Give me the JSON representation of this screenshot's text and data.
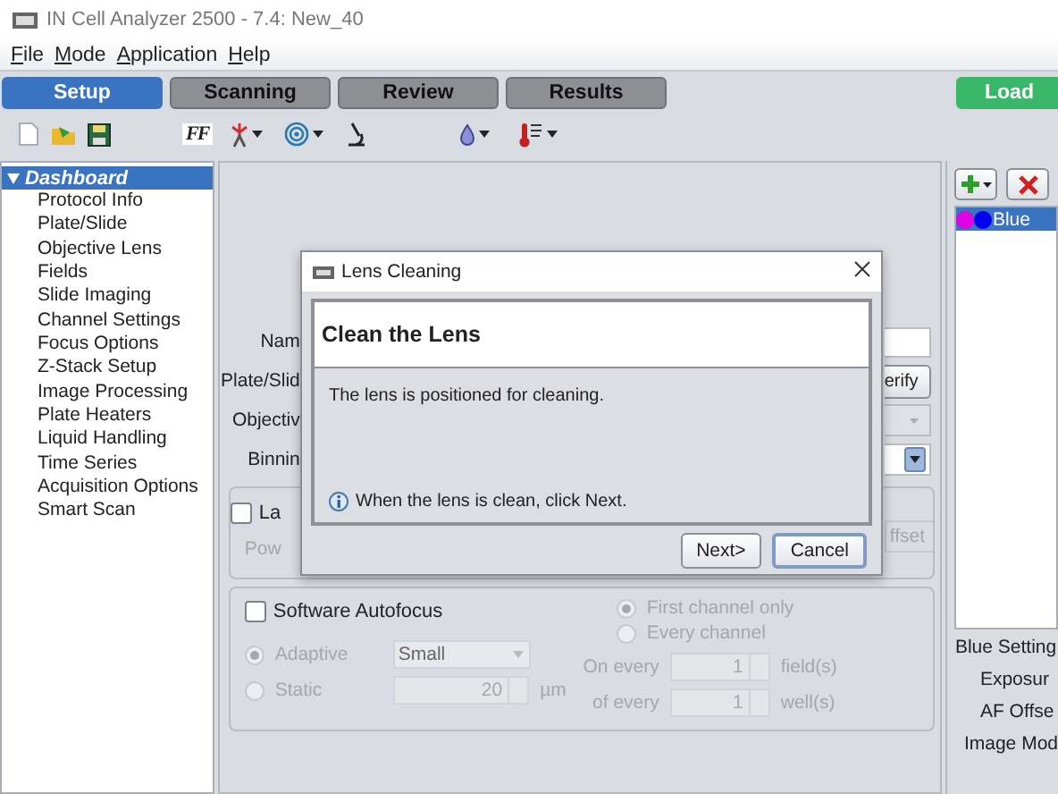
{
  "window": {
    "title": "IN Cell Analyzer 2500 - 7.4: New_40"
  },
  "menu": [
    "File",
    "Mode",
    "Application",
    "Help"
  ],
  "tabs": [
    {
      "label": "Setup",
      "selected": true
    },
    {
      "label": "Scanning",
      "selected": false
    },
    {
      "label": "Review",
      "selected": false
    },
    {
      "label": "Results",
      "selected": false
    }
  ],
  "load_button": "Load",
  "toolbar": {
    "font_button": "FF"
  },
  "sidebar": {
    "items": [
      {
        "label": "Dashboard",
        "selected": true,
        "expanded": true,
        "children": [
          {
            "label": "Protocol Info",
            "selected": false
          },
          {
            "label": "Plate/Slide",
            "selected": false
          },
          {
            "label": "Objective Lens",
            "selected": false
          },
          {
            "label": "Fields",
            "selected": false
          },
          {
            "label": "Slide Imaging",
            "selected": false
          },
          {
            "label": "Channel Settings",
            "selected": false
          },
          {
            "label": "Focus Options",
            "selected": false
          },
          {
            "label": "Z-Stack Setup",
            "selected": false
          },
          {
            "label": "Image Processing",
            "selected": false
          },
          {
            "label": "Plate Heaters",
            "selected": false
          },
          {
            "label": "Liquid Handling",
            "selected": false
          },
          {
            "label": "Time Series",
            "selected": false
          },
          {
            "label": "Acquisition Options",
            "selected": false
          },
          {
            "label": "Smart Scan",
            "selected": false
          }
        ]
      }
    ]
  },
  "form": {
    "labels": [
      "Nam",
      "Plate/Slid",
      "Objectiv",
      "Binnin"
    ],
    "verify_button": "erify",
    "laser": {
      "checkbox": "La",
      "checked": false,
      "power": "Pow",
      "offset_button": "ffset"
    }
  },
  "autofocus": {
    "label": "Software Autofocus",
    "checked": false,
    "modes": [
      {
        "label": "Adaptive",
        "selected": true
      },
      {
        "label": "Static",
        "selected": false
      }
    ],
    "size": "Small",
    "step": "20",
    "unit": "µm",
    "channels": [
      {
        "label": "First channel only",
        "selected": true
      },
      {
        "label": "Every channel",
        "selected": false
      }
    ],
    "fields_label": "On every",
    "fields_value": "1",
    "fields_unit": "field(s)",
    "wells_label": "of every",
    "wells_value": "1",
    "wells_unit": "well(s)"
  },
  "channel_panel": {
    "items": [
      {
        "label": "Blue",
        "selected": true,
        "dots": [
          {
            "color": "#e000e0"
          },
          {
            "color": "#0000f0"
          }
        ]
      }
    ],
    "labels": [
      "Blue Setting",
      "Exposur",
      "AF Offse",
      "Image Mod"
    ]
  },
  "dialog": {
    "title": "Lens Cleaning",
    "heading": "Clean the Lens",
    "message": "The lens is positioned for cleaning.",
    "hint": "When the lens is clean, click Next.",
    "buttons": [
      {
        "label": "Next>",
        "focused": false
      },
      {
        "label": "Cancel",
        "focused": true
      }
    ]
  }
}
